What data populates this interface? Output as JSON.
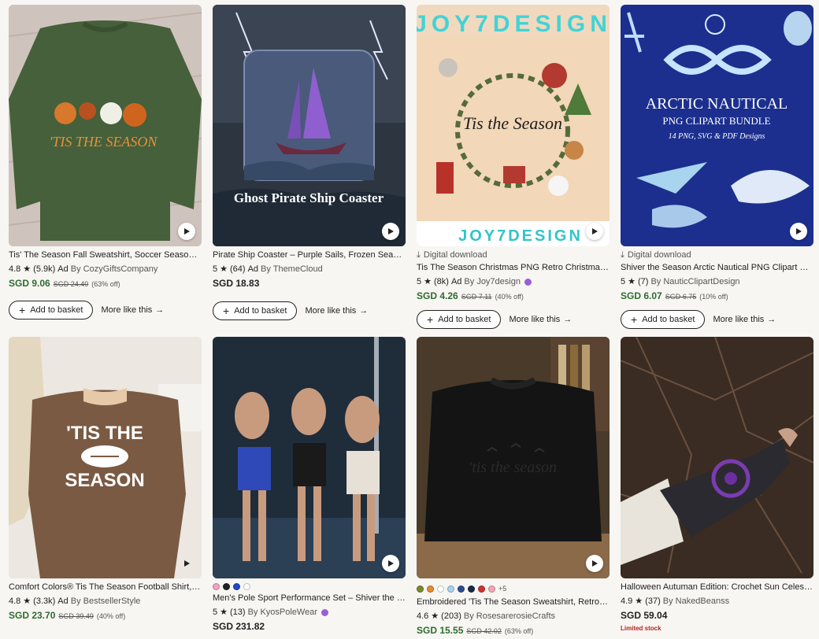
{
  "row1": [
    {
      "title": "Tis' The Season Fall Sweatshirt, Soccer Season Sw...",
      "rating": "4.8",
      "reviews": "(5.9k)",
      "ad": "Ad",
      "shop": "By CozyGiftsCompany",
      "price": "SGD 9.06",
      "original": "SGD 24.40",
      "discount": "(63% off)",
      "add_label": "Add to basket",
      "more_label": "More like this"
    },
    {
      "title": "Pirate Ship Coaster – Purple Sails, Frozen Seas, Go...",
      "rating": "5",
      "reviews": "(64)",
      "ad": "Ad",
      "shop": "By ThemeCloud",
      "price": "SGD 18.83",
      "add_label": "Add to basket",
      "more_label": "More like this",
      "image_text": "Ghost Pirate Ship Coaster"
    },
    {
      "download": "Digital download",
      "title": "Tis The Season Christmas PNG Retro Christmas s...",
      "rating": "5",
      "reviews": "(8k)",
      "ad": "Ad",
      "shop": "By Joy7design",
      "price": "SGD 4.26",
      "original": "SGD 7.11",
      "discount": "(40% off)",
      "add_label": "Add to basket",
      "more_label": "More like this",
      "image_text_top": "JOY7DESIGN",
      "image_text_center": "Tis the Season",
      "image_text_bottom": "JOY7DESIGN"
    },
    {
      "download": "Digital download",
      "title": "Shiver the Season Arctic Nautical PNG Clipart Bun...",
      "rating": "5",
      "reviews": "(7)",
      "shop": "By NauticClipartDesign",
      "price": "SGD 6.07",
      "original": "SGD 6.75",
      "discount": "(10% off)",
      "add_label": "Add to basket",
      "more_label": "More like this",
      "image_title": "ARCTIC NAUTICAL",
      "image_subtitle": "PNG CLIPART BUNDLE",
      "image_caption": "14 PNG, SVG & PDF Designs"
    }
  ],
  "row2": [
    {
      "title": "Comfort Colors® Tis The Season Football Shirt, 'Tis...",
      "rating": "4.8",
      "reviews": "(3.3k)",
      "ad": "Ad",
      "shop": "By BestsellerStyle",
      "price": "SGD 23.70",
      "original": "SGD 39.49",
      "discount": "(40% off)",
      "image_text": "'TIS THE SEASON"
    },
    {
      "title": "Men's Pole Sport Performance Set – Shiver the Sea...",
      "rating": "5",
      "reviews": "(13)",
      "shop": "By KyosPoleWear",
      "price": "SGD 231.82",
      "swatches": [
        "#f4a3c0",
        "#222222",
        "#2148c9",
        "#ffffff"
      ]
    },
    {
      "title": "Embroidered 'Tis The Season Sweatshirt, Retro Hal...",
      "rating": "4.6",
      "reviews": "(203)",
      "shop": "By RosesarerosieCrafts",
      "price": "SGD 15.55",
      "original": "SGD 42.02",
      "discount": "(63% off)",
      "swatches": [
        "#7a8a2a",
        "#e88b2d",
        "#ffffff",
        "#a7d3f2",
        "#2c4d8f",
        "#1b2a44",
        "#d0302e",
        "#f3a7b3"
      ],
      "swatch_more": "+5",
      "image_text": "'tis the season"
    },
    {
      "title": "Halloween Autuman Edition: Crochet Sun Celestial ...",
      "rating": "4.9",
      "reviews": "(37)",
      "shop": "By NakedBeanss",
      "price": "SGD 59.04",
      "limited": "Limited stock"
    }
  ]
}
